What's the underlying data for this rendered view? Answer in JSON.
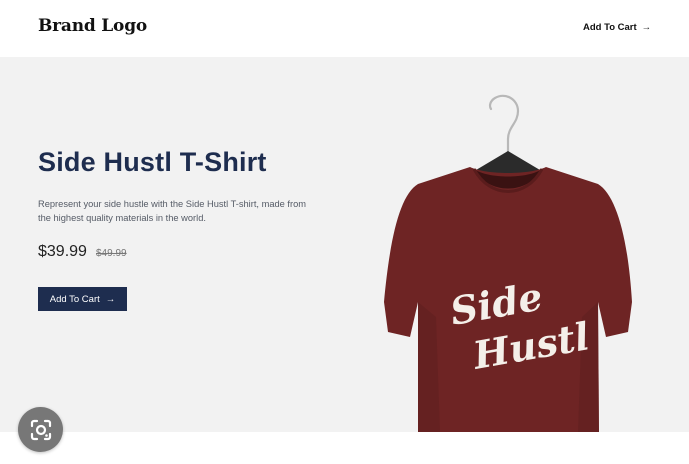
{
  "header": {
    "brand": "Brand Logo",
    "cta_label": "Add To Cart",
    "cta_arrow": "→"
  },
  "hero": {
    "title": "Side Hustl T-Shirt",
    "description": "Represent your side hustle with the Side Hustl T-shirt, made from the highest quality materials in the world.",
    "price": "$39.99",
    "old_price": "$49.99",
    "cta_label": "Add To Cart",
    "cta_arrow": "→"
  },
  "image": {
    "shirt_color": "#6e2424",
    "print_line1": "Side",
    "print_line2": "Hustl"
  },
  "colors": {
    "navy": "#1e2d4f",
    "hero_bg": "#f2f2f2"
  },
  "icons": {
    "header_arrow": "arrow-right-icon",
    "cta_arrow": "arrow-right-icon",
    "lens": "visual-search-icon"
  }
}
